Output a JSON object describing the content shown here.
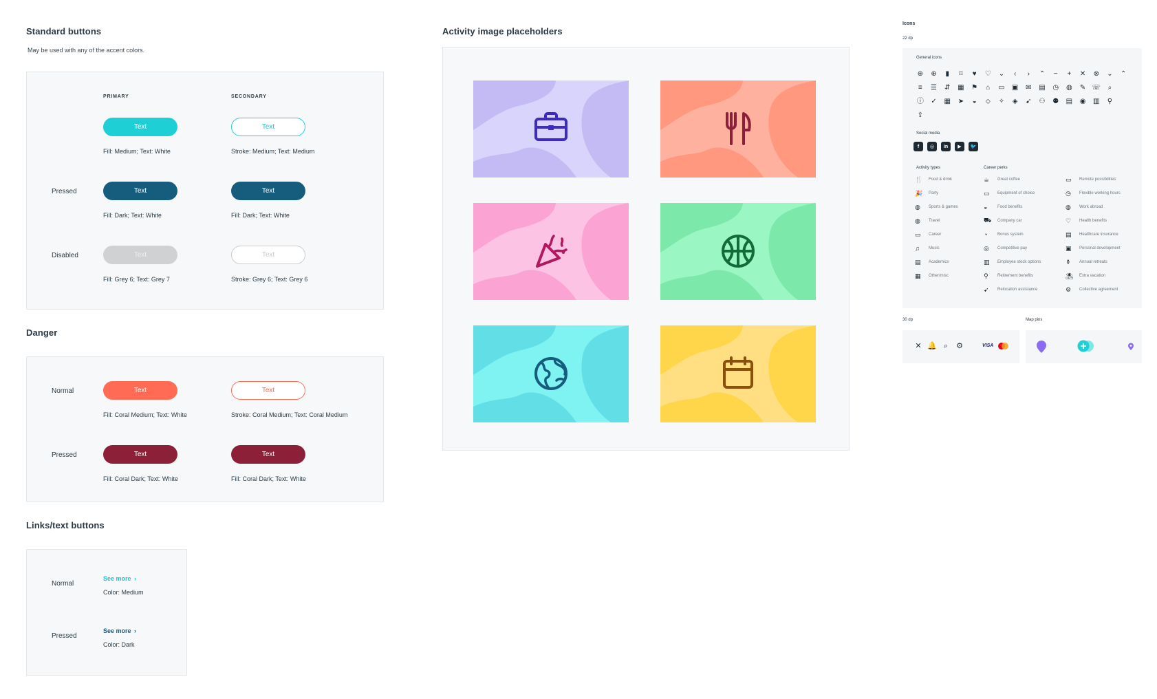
{
  "standard": {
    "title": "Standard buttons",
    "subtitle": "May be used with any of the accent colors.",
    "col_primary": "PRIMARY",
    "col_secondary": "SECONDARY",
    "row_pressed": "Pressed",
    "row_disabled": "Disabled",
    "btn_text": "Text",
    "cap_primary_normal": "Fill: Medium; Text: White",
    "cap_secondary_normal": "Stroke: Medium; Text: Medium",
    "cap_primary_pressed": "Fill: Dark; Text: White",
    "cap_secondary_pressed": "Fill: Dark; Text: White",
    "cap_primary_disabled": "Fill: Grey 6; Text: Grey 7",
    "cap_secondary_disabled": "Stroke: Grey 6; Text: Grey 6"
  },
  "danger": {
    "title": "Danger",
    "row_normal": "Normal",
    "row_pressed": "Pressed",
    "btn_text": "Text",
    "cap_primary_normal": "Fill: Coral Medium; Text: White",
    "cap_secondary_normal": "Stroke: Coral Medium; Text: Coral Medium",
    "cap_primary_pressed": "Fill: Coral Dark; Text: White",
    "cap_secondary_pressed": "Fill: Coral Dark; Text: White"
  },
  "links": {
    "title": "Links/text buttons",
    "row_normal": "Normal",
    "row_pressed": "Pressed",
    "link_text": "See more",
    "chevron": "›",
    "cap_normal": "Color: Medium",
    "cap_pressed": "Color: Dark"
  },
  "activity": {
    "title": "Activity image placeholders",
    "cards": [
      {
        "icon": "briefcase-icon",
        "base": "#d9d4fb",
        "blob": "#c4bbf5",
        "ink": "#3b2bc0"
      },
      {
        "icon": "fork-knife-icon",
        "base": "#ffb1a0",
        "blob": "#ff987f",
        "ink": "#8c2039"
      },
      {
        "icon": "party-popper-icon",
        "base": "#fdc3e4",
        "blob": "#fba4d4",
        "ink": "#b0185f"
      },
      {
        "icon": "basketball-icon",
        "base": "#9af7c3",
        "blob": "#7ce8a9",
        "ink": "#146b3a"
      },
      {
        "icon": "globe-icon",
        "base": "#7ff2f2",
        "blob": "#62dfe6",
        "ink": "#165c7d"
      },
      {
        "icon": "calendar-icon",
        "base": "#ffdf82",
        "blob": "#ffd64a",
        "ink": "#8a4f0b"
      }
    ]
  },
  "icons": {
    "title": "Icons",
    "size22": "22 dp",
    "general_title": "General icons",
    "general_rows": [
      [
        "⊕",
        "⊕",
        "▮",
        "⌑",
        "♥",
        "♡",
        "⌄",
        "‹",
        "›",
        "⌃",
        "−",
        "+",
        "✕",
        "⊗",
        "⌄",
        "⌃"
      ],
      [
        "≡",
        "☰",
        "⇵",
        "▦",
        "⚑",
        "⌂",
        "▭",
        "▣",
        "✉",
        "▤",
        "◷",
        "◍",
        "✎",
        "☏",
        "⌕"
      ],
      [
        "ⓘ",
        "✓",
        "▦",
        "➤",
        "◒",
        "⬦",
        "✧",
        "◈",
        "➹",
        "⚇",
        "⚉",
        "▤",
        "◉",
        "▥",
        "⚲"
      ],
      [
        "⇪"
      ]
    ],
    "social_title": "Social media",
    "social": [
      "f",
      "◎",
      "in",
      "▶",
      "🐦"
    ],
    "activity_types_title": "Activity types",
    "activity_types": [
      {
        "g": "🍴",
        "t": "Food & drink"
      },
      {
        "g": "🎉",
        "t": "Party"
      },
      {
        "g": "◍",
        "t": "Sports & games"
      },
      {
        "g": "◍",
        "t": "Travel"
      },
      {
        "g": "▭",
        "t": "Career"
      },
      {
        "g": "♫",
        "t": "Music"
      },
      {
        "g": "▤",
        "t": "Academics"
      },
      {
        "g": "▦",
        "t": "Other/misc"
      }
    ],
    "career_title": "Career perks",
    "career_a": [
      {
        "g": "☕",
        "t": "Great coffee"
      },
      {
        "g": "▭",
        "t": "Equipment of choice"
      },
      {
        "g": "◒",
        "t": "Food benefits"
      },
      {
        "g": "⛟",
        "t": "Company car"
      },
      {
        "g": "◔",
        "t": "Bonus system"
      },
      {
        "g": "◎",
        "t": "Competitive pay"
      },
      {
        "g": "▥",
        "t": "Employee stock options"
      },
      {
        "g": "⚲",
        "t": "Retirement benefits"
      },
      {
        "g": "➹",
        "t": "Relocation assistance"
      }
    ],
    "career_b": [
      {
        "g": "▭",
        "t": "Remote possibilities"
      },
      {
        "g": "◷",
        "t": "Flexible working hours"
      },
      {
        "g": "◍",
        "t": "Work abroad"
      },
      {
        "g": "♡",
        "t": "Health benefits"
      },
      {
        "g": "▤",
        "t": "Healthcare insurance"
      },
      {
        "g": "▣",
        "t": "Personal development"
      },
      {
        "g": "⚱",
        "t": "Annual retreats"
      },
      {
        "g": "⛱",
        "t": "Extra vacation"
      },
      {
        "g": "⚙",
        "t": "Collective agreement"
      }
    ],
    "size30": "30 dp",
    "icons30": [
      "✕",
      "🔔",
      "⌕",
      "⚙"
    ],
    "visa": "VISA",
    "pins_title": "Map pins"
  },
  "colors": {
    "medium": "#1ed0d6",
    "dark": "#165c7d",
    "coral_medium": "#ff6b55",
    "coral_dark": "#8c2039",
    "grey6": "#cfd1d3"
  }
}
